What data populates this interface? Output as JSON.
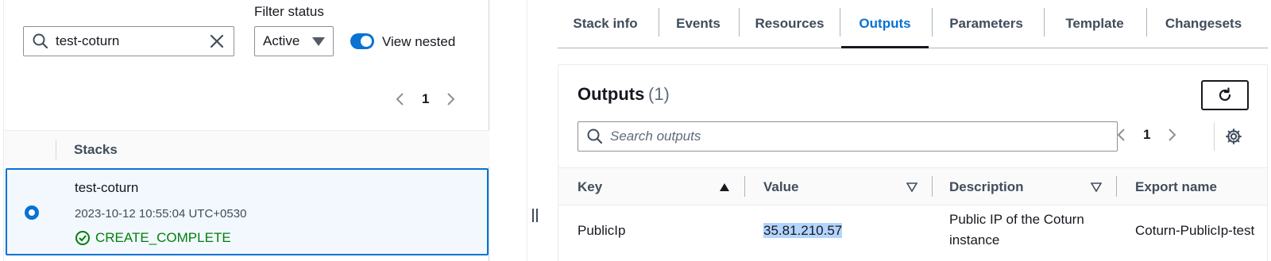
{
  "left": {
    "search": {
      "value": "test-coturn"
    },
    "filter": {
      "label": "Filter status",
      "selected": "Active"
    },
    "nested_toggle": {
      "label": "View nested",
      "on": true
    },
    "pager": {
      "page": "1"
    },
    "table": {
      "header": "Stacks"
    },
    "stack": {
      "name": "test-coturn",
      "timestamp": "2023-10-12 10:55:04 UTC+0530",
      "status": "CREATE_COMPLETE"
    }
  },
  "tabs": [
    {
      "label": "Stack info"
    },
    {
      "label": "Events"
    },
    {
      "label": "Resources"
    },
    {
      "label": "Outputs"
    },
    {
      "label": "Parameters"
    },
    {
      "label": "Template"
    },
    {
      "label": "Changesets"
    }
  ],
  "active_tab": "Outputs",
  "outputs": {
    "title": "Outputs",
    "count": "(1)",
    "search_placeholder": "Search outputs",
    "page": "1",
    "columns": [
      "Key",
      "Value",
      "Description",
      "Export name"
    ],
    "rows": [
      {
        "key": "PublicIp",
        "value": "35.81.210.57",
        "description": "Public IP of the Coturn instance",
        "export": "Coturn-PublicIp-test"
      }
    ]
  },
  "colors": {
    "accent": "#0972d3",
    "success": "#037f0c",
    "selected_bg": "#f2f8fd",
    "highlight": "#b3d4fc"
  }
}
